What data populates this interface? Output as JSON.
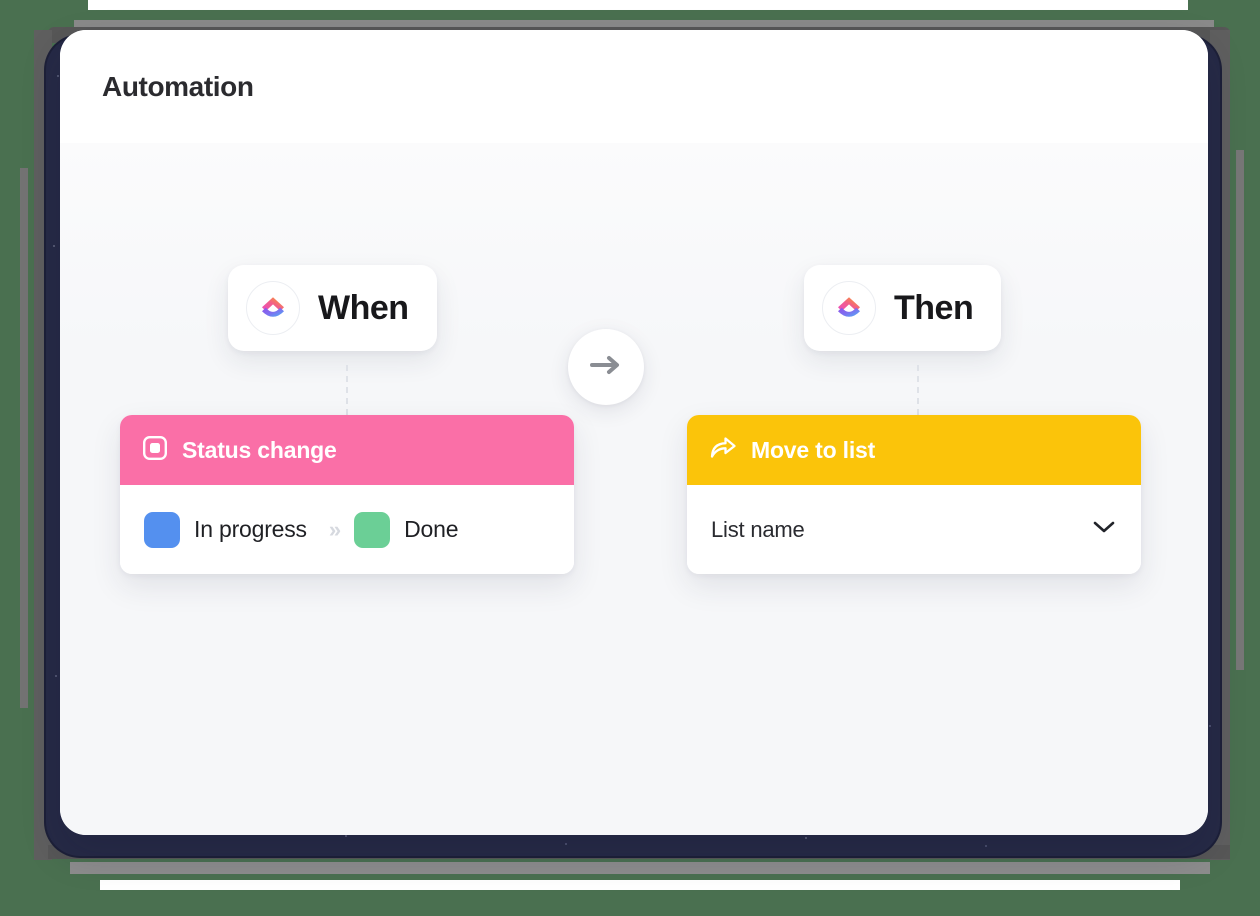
{
  "window": {
    "title": "Automation"
  },
  "colors": {
    "pink": "#fa6fa7",
    "yellow": "#fbc40a",
    "status_blue": "#5490ef",
    "status_green": "#6bcf96",
    "canvas_bg": "#f6f7f9",
    "title_text": "#2b2b2f"
  },
  "flow": {
    "trigger": {
      "pill_label": "When",
      "pill_icon": "clickup-logo-icon",
      "card": {
        "header_icon": "status-square-icon",
        "header_title": "Status change",
        "from_status": {
          "label": "In progress",
          "color": "#5490ef"
        },
        "separator_icon": "double-chevron-right-icon",
        "to_status": {
          "label": "Done",
          "color": "#6bcf96"
        }
      }
    },
    "connector_icon": "arrow-right-icon",
    "action": {
      "pill_label": "Then",
      "pill_icon": "clickup-logo-icon",
      "card": {
        "header_icon": "share-arrow-icon",
        "header_title": "Move to list",
        "select_value": "List name",
        "select_icon": "chevron-down-icon"
      }
    }
  }
}
